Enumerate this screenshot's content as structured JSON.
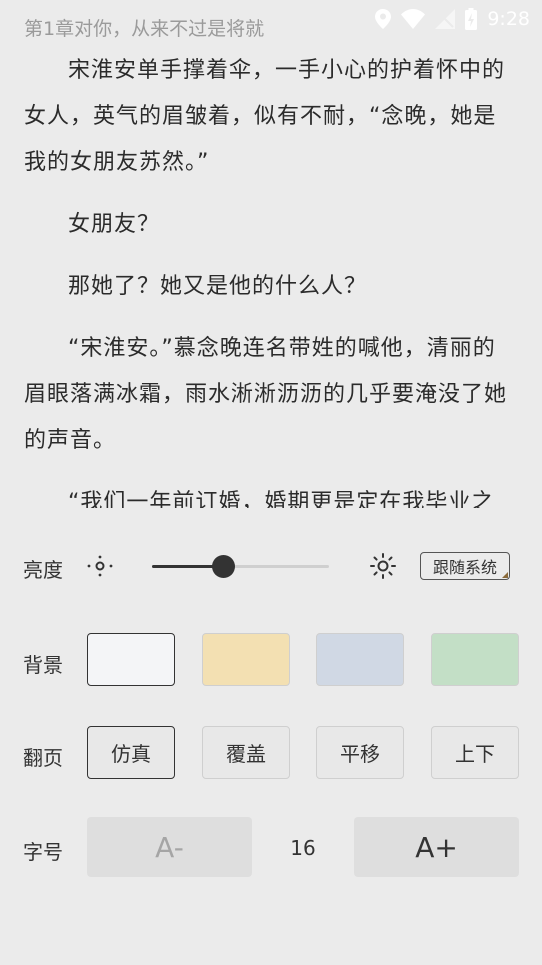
{
  "status": {
    "chapter_title": "第1章对你，从来不过是将就",
    "time": "9:28",
    "icons": [
      "location-icon",
      "wifi-icon",
      "signal-off-icon",
      "battery-charging-icon"
    ]
  },
  "reader": {
    "paragraphs": [
      "宋淮安单手撑着伞，一手小心的护着怀中的女人，英气的眉皱着，似有不耐，“念晚，她是我的女朋友苏然。”",
      "女朋友？",
      "那她了？她又是他的什么人？",
      "“宋淮安。”慕念晚连名带姓的喊他，清丽的眉眼落满冰霜，雨水淅淅沥沥的几乎要淹没了她的声音。",
      "“我们一年前订婚，婚期更是定在我毕业之"
    ]
  },
  "settings": {
    "brightness": {
      "label": "亮度",
      "level": 0.4,
      "follow_system_label": "跟随系统"
    },
    "background": {
      "label": "背景",
      "colors": [
        "#f4f5f7",
        "#f3e0b2",
        "#d0d8e4",
        "#c3dfc6"
      ],
      "selected_index": 0
    },
    "page_turn": {
      "label": "翻页",
      "modes": [
        "仿真",
        "覆盖",
        "平移",
        "上下"
      ],
      "selected_index": 0
    },
    "font_size": {
      "label": "字号",
      "decrease_label": "A-",
      "increase_label": "A+",
      "value": "16"
    }
  }
}
